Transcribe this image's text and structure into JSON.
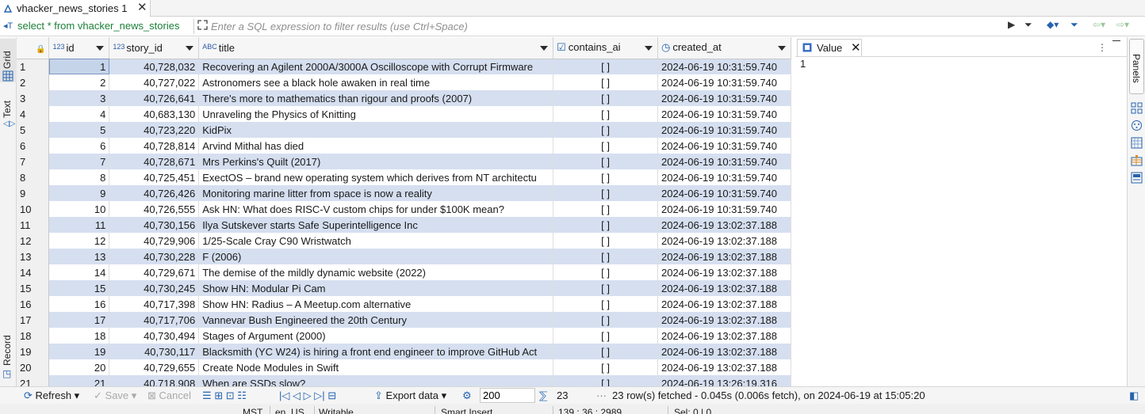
{
  "tab": {
    "title": "vhacker_news_stories 1",
    "close": "✕"
  },
  "filter": {
    "sql_label": "select * from vhacker_news_stories",
    "placeholder": "Enter a SQL expression to filter results (use Ctrl+Space)"
  },
  "left_tabs": {
    "grid": "Grid",
    "text": "Text",
    "record": "Record"
  },
  "columns": [
    {
      "name": "id",
      "type": "123"
    },
    {
      "name": "story_id",
      "type": "123"
    },
    {
      "name": "title",
      "type": "ABC"
    },
    {
      "name": "contains_ai",
      "type": "checkbox"
    },
    {
      "name": "created_at",
      "type": "clock"
    }
  ],
  "rows": [
    {
      "n": "1",
      "id": "1",
      "story_id": "40,728,032",
      "title": "Recovering an Agilent 2000A/3000A Oscilloscope with Corrupt Firmware",
      "ai": "[ ]",
      "created": "2024-06-19 10:31:59.740"
    },
    {
      "n": "2",
      "id": "2",
      "story_id": "40,727,022",
      "title": "Astronomers see a black hole awaken in real time",
      "ai": "[ ]",
      "created": "2024-06-19 10:31:59.740"
    },
    {
      "n": "3",
      "id": "3",
      "story_id": "40,726,641",
      "title": "There's more to mathematics than rigour and proofs (2007)",
      "ai": "[ ]",
      "created": "2024-06-19 10:31:59.740"
    },
    {
      "n": "4",
      "id": "4",
      "story_id": "40,683,130",
      "title": "Unraveling the Physics of Knitting",
      "ai": "[ ]",
      "created": "2024-06-19 10:31:59.740"
    },
    {
      "n": "5",
      "id": "5",
      "story_id": "40,723,220",
      "title": "KidPix",
      "ai": "[ ]",
      "created": "2024-06-19 10:31:59.740"
    },
    {
      "n": "6",
      "id": "6",
      "story_id": "40,728,814",
      "title": "Arvind Mithal has died",
      "ai": "[ ]",
      "created": "2024-06-19 10:31:59.740"
    },
    {
      "n": "7",
      "id": "7",
      "story_id": "40,728,671",
      "title": "Mrs Perkins's Quilt (2017)",
      "ai": "[ ]",
      "created": "2024-06-19 10:31:59.740"
    },
    {
      "n": "8",
      "id": "8",
      "story_id": "40,725,451",
      "title": "ExectOS – brand new operating system which derives from NT architectu",
      "ai": "[ ]",
      "created": "2024-06-19 10:31:59.740"
    },
    {
      "n": "9",
      "id": "9",
      "story_id": "40,726,426",
      "title": "Monitoring marine litter from space is now a reality",
      "ai": "[ ]",
      "created": "2024-06-19 10:31:59.740"
    },
    {
      "n": "10",
      "id": "10",
      "story_id": "40,726,555",
      "title": "Ask HN: What does RISC-V custom chips for under $100K mean?",
      "ai": "[ ]",
      "created": "2024-06-19 10:31:59.740"
    },
    {
      "n": "11",
      "id": "11",
      "story_id": "40,730,156",
      "title": "Ilya Sutskever starts Safe Superintelligence Inc",
      "ai": "[ ]",
      "created": "2024-06-19 13:02:37.188"
    },
    {
      "n": "12",
      "id": "12",
      "story_id": "40,729,906",
      "title": "1/25-Scale Cray C90 Wristwatch",
      "ai": "[ ]",
      "created": "2024-06-19 13:02:37.188"
    },
    {
      "n": "13",
      "id": "13",
      "story_id": "40,730,228",
      "title": "F (2006)",
      "ai": "[ ]",
      "created": "2024-06-19 13:02:37.188"
    },
    {
      "n": "14",
      "id": "14",
      "story_id": "40,729,671",
      "title": "The demise of the mildly dynamic website (2022)",
      "ai": "[ ]",
      "created": "2024-06-19 13:02:37.188"
    },
    {
      "n": "15",
      "id": "15",
      "story_id": "40,730,245",
      "title": "Show HN: Modular Pi Cam",
      "ai": "[ ]",
      "created": "2024-06-19 13:02:37.188"
    },
    {
      "n": "16",
      "id": "16",
      "story_id": "40,717,398",
      "title": "Show HN: Radius – A Meetup.com alternative",
      "ai": "[ ]",
      "created": "2024-06-19 13:02:37.188"
    },
    {
      "n": "17",
      "id": "17",
      "story_id": "40,717,706",
      "title": "Vannevar Bush Engineered the 20th Century",
      "ai": "[ ]",
      "created": "2024-06-19 13:02:37.188"
    },
    {
      "n": "18",
      "id": "18",
      "story_id": "40,730,494",
      "title": "Stages of Argument (2000)",
      "ai": "[ ]",
      "created": "2024-06-19 13:02:37.188"
    },
    {
      "n": "19",
      "id": "19",
      "story_id": "40,730,117",
      "title": "Blacksmith (YC W24) is hiring a front end engineer to improve GitHub Act",
      "ai": "[ ]",
      "created": "2024-06-19 13:02:37.188"
    },
    {
      "n": "20",
      "id": "20",
      "story_id": "40,729,655",
      "title": "Create Node Modules in Swift",
      "ai": "[ ]",
      "created": "2024-06-19 13:02:37.188"
    },
    {
      "n": "21",
      "id": "21",
      "story_id": "40,718,908",
      "title": "When are SSDs slow?",
      "ai": "[ ]",
      "created": "2024-06-19 13:26:19.316"
    }
  ],
  "value_panel": {
    "tab_label": "Value",
    "value": "1",
    "close": "✕"
  },
  "right_strip": {
    "panels_label": "Panels"
  },
  "bottom": {
    "refresh": "Refresh",
    "save": "Save",
    "cancel": "Cancel",
    "export": "Export data",
    "limit": "200",
    "row_count": "23",
    "status": "23 row(s) fetched - 0.045s (0.006s fetch), on 2024-06-19 at 15:05:20"
  },
  "statusbar": {
    "tz": "MST",
    "locale": "en_US",
    "mode": "Writable",
    "insert": "Smart Insert",
    "position": "139 : 36 : 2989",
    "sel": "Sel: 0 | 0"
  },
  "colors": {
    "accent": "#2563b0",
    "row_alt": "#d5dff0",
    "sql_green": "#1a7f37"
  }
}
